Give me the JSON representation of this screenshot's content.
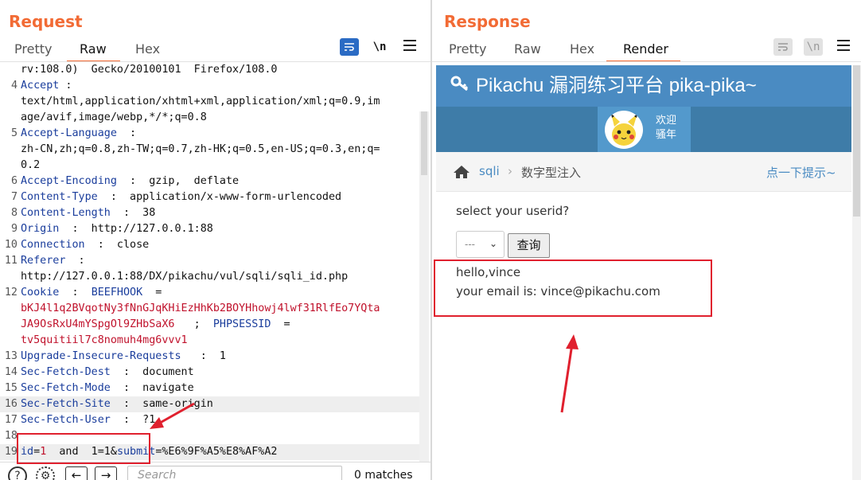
{
  "request": {
    "title": "Request",
    "tabs": [
      "Pretty",
      "Raw",
      "Hex"
    ],
    "active_tab": "Raw",
    "wrap_toggle": "\\n",
    "lines": [
      {
        "num": "",
        "parts": [
          {
            "t": "rv:108.0)  Gecko/20100101  Firefox/108.0",
            "c": "hv"
          }
        ]
      },
      {
        "num": "4",
        "parts": [
          {
            "t": "Accept",
            "c": "hk"
          },
          {
            "t": " :",
            "c": "hv"
          }
        ]
      },
      {
        "num": "",
        "parts": [
          {
            "t": "text/html,application/xhtml+xml,application/xml;q=0.9,im",
            "c": "hv"
          }
        ]
      },
      {
        "num": "",
        "parts": [
          {
            "t": "age/avif,image/webp,*/*;q=0.8",
            "c": "hv"
          }
        ]
      },
      {
        "num": "5",
        "parts": [
          {
            "t": "Accept-Language",
            "c": "hk"
          },
          {
            "t": "  :",
            "c": "hv"
          }
        ]
      },
      {
        "num": "",
        "parts": [
          {
            "t": "zh-CN,zh;q=0.8,zh-TW;q=0.7,zh-HK;q=0.5,en-US;q=0.3,en;q=",
            "c": "hv"
          }
        ]
      },
      {
        "num": "",
        "parts": [
          {
            "t": "0.2",
            "c": "hv"
          }
        ]
      },
      {
        "num": "6",
        "parts": [
          {
            "t": "Accept-Encoding",
            "c": "hk"
          },
          {
            "t": "  :  gzip,  deflate",
            "c": "hv"
          }
        ]
      },
      {
        "num": "7",
        "parts": [
          {
            "t": "Content-Type",
            "c": "hk"
          },
          {
            "t": "  :  application/x-www-form-urlencoded",
            "c": "hv"
          }
        ]
      },
      {
        "num": "8",
        "parts": [
          {
            "t": "Content-Length",
            "c": "hk"
          },
          {
            "t": "  :  38",
            "c": "hv"
          }
        ]
      },
      {
        "num": "9",
        "parts": [
          {
            "t": "Origin",
            "c": "hk"
          },
          {
            "t": "  :  http://127.0.0.1:88",
            "c": "hv"
          }
        ]
      },
      {
        "num": "10",
        "parts": [
          {
            "t": "Connection",
            "c": "hk"
          },
          {
            "t": "  :  close",
            "c": "hv"
          }
        ]
      },
      {
        "num": "11",
        "parts": [
          {
            "t": "Referer",
            "c": "hk"
          },
          {
            "t": "  :",
            "c": "hv"
          }
        ]
      },
      {
        "num": "",
        "parts": [
          {
            "t": "http://127.0.0.1:88/DX/pikachu/vul/sqli/sqli_id.php",
            "c": "hv"
          }
        ]
      },
      {
        "num": "12",
        "parts": [
          {
            "t": "Cookie",
            "c": "hk"
          },
          {
            "t": "  :  ",
            "c": "hv"
          },
          {
            "t": "BEEFHOOK",
            "c": "hk"
          },
          {
            "t": "  =",
            "c": "hv"
          }
        ]
      },
      {
        "num": "",
        "parts": [
          {
            "t": "bKJ4l1q2BVqotNy3fNnGJqKHiEzHhKb2BOYHhowj4lwf31RlfEo7YQta",
            "c": "ck"
          }
        ]
      },
      {
        "num": "",
        "parts": [
          {
            "t": "JA9OsRxU4mYSpgOl9ZHbSaX6",
            "c": "ck"
          },
          {
            "t": "   ;  ",
            "c": "hv"
          },
          {
            "t": "PHPSESSID",
            "c": "hk"
          },
          {
            "t": "  =",
            "c": "hv"
          }
        ]
      },
      {
        "num": "",
        "parts": [
          {
            "t": "tv5quitiil7c8nomuh4mg6vvv1",
            "c": "ck"
          }
        ]
      },
      {
        "num": "13",
        "parts": [
          {
            "t": "Upgrade-Insecure-Requests",
            "c": "hk"
          },
          {
            "t": "   :  1",
            "c": "hv"
          }
        ]
      },
      {
        "num": "14",
        "parts": [
          {
            "t": "Sec-Fetch-Dest",
            "c": "hk"
          },
          {
            "t": "  :  document",
            "c": "hv"
          }
        ]
      },
      {
        "num": "15",
        "parts": [
          {
            "t": "Sec-Fetch-Mode",
            "c": "hk"
          },
          {
            "t": "  :  navigate",
            "c": "hv"
          }
        ]
      },
      {
        "num": "16",
        "parts": [
          {
            "t": "Sec-Fetch-Site",
            "c": "hk"
          },
          {
            "t": "  :  same-origin",
            "c": "hv"
          }
        ],
        "highlight": true
      },
      {
        "num": "17",
        "parts": [
          {
            "t": "Sec-Fetch-User",
            "c": "hk"
          },
          {
            "t": "  :  ?1",
            "c": "hv"
          }
        ]
      },
      {
        "num": "18",
        "parts": []
      },
      {
        "num": "19",
        "parts": [
          {
            "t": "id",
            "c": "hk"
          },
          {
            "t": "=",
            "c": "hv"
          },
          {
            "t": "1",
            "c": "ck"
          },
          {
            "t": "  and  1=1&",
            "c": "hv"
          },
          {
            "t": "submit",
            "c": "hk"
          },
          {
            "t": "=%E6%9F%A5%E8%AF%A2",
            "c": "hv"
          }
        ],
        "highlight": true
      }
    ],
    "search": {
      "placeholder": "Search",
      "matches": "0 matches"
    }
  },
  "response": {
    "title": "Response",
    "tabs": [
      "Pretty",
      "Raw",
      "Hex",
      "Render"
    ],
    "active_tab": "Render",
    "wrap_toggle": "\\n"
  },
  "render": {
    "site_title": "Pikachu 漏洞练习平台 pika-pika~",
    "welcome_line1": "欢迎",
    "welcome_line2": "骚年",
    "breadcrumb": {
      "link": "sqli",
      "current": "数字型注入",
      "hint": "点一下提示~"
    },
    "select_label": "select your userid?",
    "select_value": "---",
    "submit_label": "查询",
    "result_line1": "hello,vince",
    "result_line2": "your email is: vince@pikachu.com"
  },
  "colors": {
    "accent": "#f26b35",
    "brand": "#4a8bc2",
    "annotation": "#e0202e",
    "header_key": "#1a3d9c",
    "cookie_value": "#c0122c"
  },
  "icons": [
    "menu-icon",
    "wrap-icon",
    "help-icon",
    "settings-icon",
    "prev-arrow-icon",
    "next-arrow-icon",
    "key-icon",
    "home-icon",
    "chevron-down-icon",
    "pikachu-avatar"
  ]
}
